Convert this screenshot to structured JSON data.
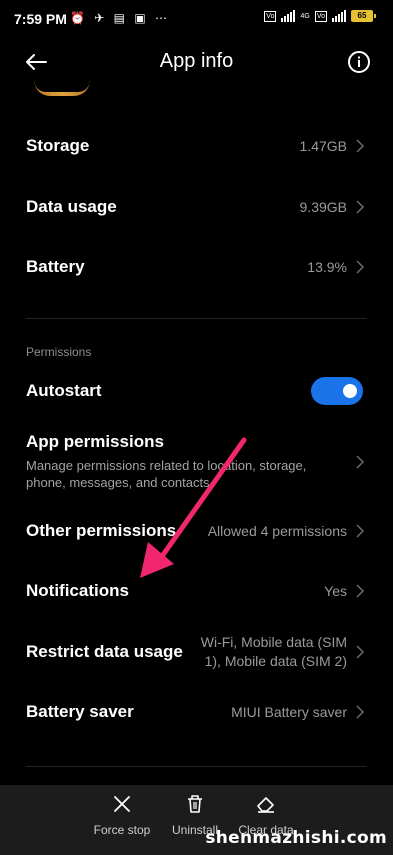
{
  "status_bar": {
    "time": "7:59 PM",
    "left_icons": "⏰ ✈ ▤ ▣ ⋯",
    "battery": "65",
    "sim_label": "4G"
  },
  "header": {
    "title": "App info"
  },
  "rows": [
    {
      "label": "Storage",
      "value": "1.47GB"
    },
    {
      "label": "Data usage",
      "value": "9.39GB"
    },
    {
      "label": "Battery",
      "value": "13.9%"
    }
  ],
  "permissions": {
    "section_title": "Permissions",
    "autostart": {
      "label": "Autostart",
      "enabled": true
    },
    "app_permissions": {
      "label": "App permissions",
      "description": "Manage permissions related to location, storage, phone, messages, and contacts."
    },
    "other_permissions": {
      "label": "Other permissions",
      "value": "Allowed 4 permissions"
    },
    "notifications": {
      "label": "Notifications",
      "value": "Yes"
    },
    "restrict_data": {
      "label": "Restrict data usage",
      "value_line1": "Wi-Fi, Mobile data (SIM",
      "value_line2": "1), Mobile data (SIM 2)"
    },
    "battery_saver": {
      "label": "Battery saver",
      "value": "MIUI Battery saver"
    }
  },
  "bottom_actions": [
    {
      "label": "Force stop",
      "icon": "close-icon"
    },
    {
      "label": "Uninstall",
      "icon": "trash-icon"
    },
    {
      "label": "Clear data",
      "icon": "eraser-icon"
    }
  ],
  "watermark": "shenmazhishi.com",
  "colors": {
    "toggle": "#1a73e8",
    "arrow": "#f0266f",
    "background": "#000000"
  }
}
